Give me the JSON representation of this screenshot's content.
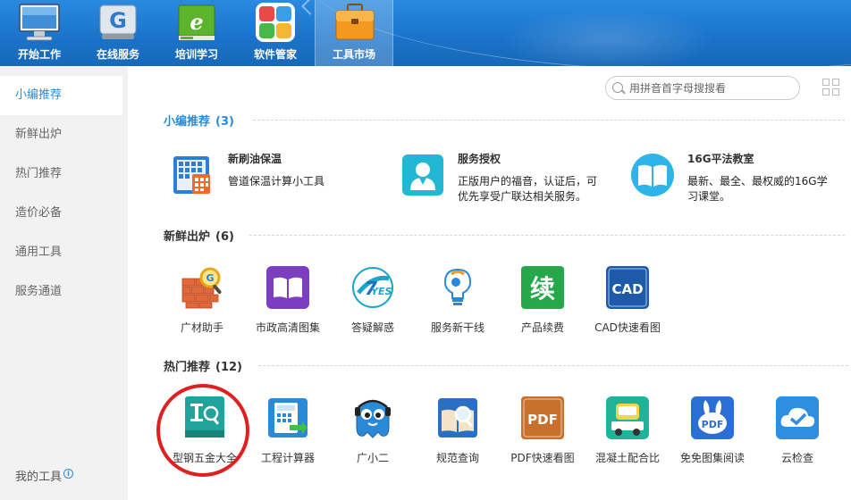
{
  "topnav": {
    "items": [
      {
        "label": "开始工作",
        "icon": "monitor-icon"
      },
      {
        "label": "在线服务",
        "icon": "online-service-icon"
      },
      {
        "label": "培训学习",
        "icon": "training-icon"
      },
      {
        "label": "软件管家",
        "icon": "software-manager-icon"
      },
      {
        "label": "工具市场",
        "icon": "toolbox-icon",
        "active": true
      }
    ]
  },
  "sidebar": {
    "items": [
      {
        "label": "小编推荐",
        "active": true
      },
      {
        "label": "新鲜出炉"
      },
      {
        "label": "热门推荐"
      },
      {
        "label": "造价必备"
      },
      {
        "label": "通用工具"
      },
      {
        "label": "服务通道"
      }
    ],
    "my_tools": "我的工具"
  },
  "search": {
    "placeholder": "用拼音首字母搜搜看"
  },
  "sections": {
    "editor": {
      "title": "小编推荐",
      "count": "(3)"
    },
    "fresh": {
      "title": "新鲜出炉",
      "count": "(6)"
    },
    "hot": {
      "title": "热门推荐",
      "count": "(12)"
    }
  },
  "featured": [
    {
      "title": "新刷油保温",
      "desc": "管道保温计算小工具",
      "icon": "calculator-grid-icon"
    },
    {
      "title": "服务授权",
      "desc": "正版用户的福音，认证后，可优先享受广联达相关服务。",
      "icon": "user-auth-icon"
    },
    {
      "title": "16G平法教室",
      "desc": "最新、最全、最权威的16G学习课堂。",
      "icon": "open-book-icon"
    }
  ],
  "fresh_apps": [
    {
      "label": "广材助手",
      "icon": "brick-magnifier-icon"
    },
    {
      "label": "市政高清图集",
      "icon": "purple-book-icon"
    },
    {
      "label": "答疑解惑",
      "icon": "yes-badge-icon"
    },
    {
      "label": "服务新干线",
      "icon": "lightbulb-head-icon"
    },
    {
      "label": "产品续费",
      "icon": "renew-icon",
      "glyph": "续"
    },
    {
      "label": "CAD快速看图",
      "icon": "cad-viewer-icon",
      "glyph": "CAD"
    }
  ],
  "hot_apps": [
    {
      "label": "型钢五金大全",
      "icon": "steel-book-icon"
    },
    {
      "label": "工程计算器",
      "icon": "calculator-icon"
    },
    {
      "label": "广小二",
      "icon": "mascot-icon"
    },
    {
      "label": "规范查询",
      "icon": "spec-search-icon"
    },
    {
      "label": "PDF快速看图",
      "icon": "pdf-viewer-icon",
      "glyph": "PDF"
    },
    {
      "label": "混凝土配合比",
      "icon": "concrete-mixer-icon"
    },
    {
      "label": "免免图集阅读",
      "icon": "rabbit-pdf-icon",
      "glyph": "PDF"
    },
    {
      "label": "云检查",
      "icon": "cloud-check-icon"
    }
  ],
  "colors": {
    "accent": "#2a8ad8",
    "topbar": "#1b74cb",
    "highlight": "#e02020"
  }
}
